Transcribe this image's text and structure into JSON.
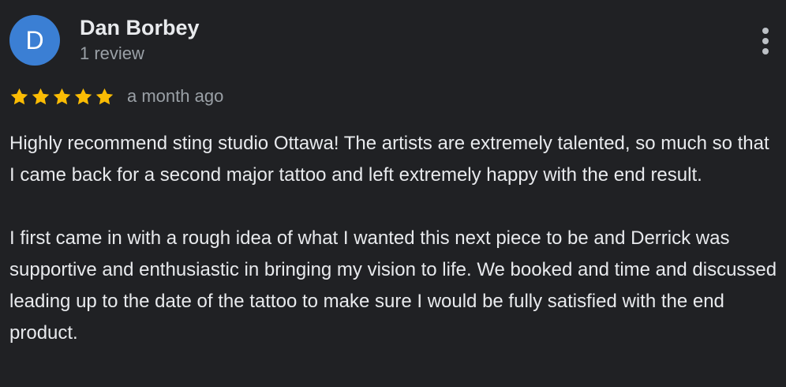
{
  "reviewer": {
    "initial": "D",
    "name": "Dan Borbey",
    "review_count": "1 review",
    "avatar_color": "#3b7fd4"
  },
  "review": {
    "rating": 5,
    "max_rating": 5,
    "star_color": "#fbbc04",
    "date": "a month ago",
    "paragraphs": [
      "Highly recommend sting studio Ottawa! The artists are extremely talented, so much so that I came back for a second major tattoo and left extremely happy with the end result.",
      "I first came in with a rough idea of what I wanted this next piece to be and Derrick was supportive and enthusiastic in bringing my vision to life. We booked and time and discussed leading up to the date of the tattoo to make sure I would be fully satisfied with the end product."
    ]
  },
  "icons": {
    "more": "more-vert-icon",
    "star": "star-icon"
  },
  "theme": {
    "background": "#202124",
    "text": "#e8eaed",
    "secondary_text": "#9aa0a6"
  }
}
